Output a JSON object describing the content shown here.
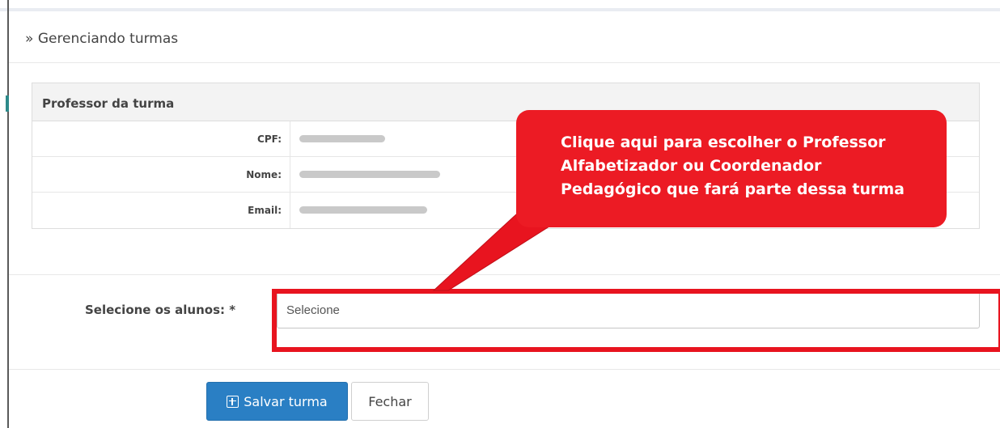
{
  "header": {
    "breadcrumb_glyph": "»",
    "title": "Gerenciando turmas"
  },
  "professor_table": {
    "heading": "Professor da turma",
    "rows": [
      {
        "label": "CPF:"
      },
      {
        "label": "Nome:"
      },
      {
        "label": "Email:"
      }
    ]
  },
  "form": {
    "students_label": "Selecione os alunos: *",
    "students_placeholder": "Selecione"
  },
  "actions": {
    "save_label": "Salvar turma",
    "close_label": "Fechar"
  },
  "annotation": {
    "callout_text": "Clique aqui para escolher o Professor Alfabetizador ou Coordenador Pedagógico que fará parte dessa turma"
  },
  "colors": {
    "accent_blue": "#2a7fc4",
    "annotation_red": "#ec1b24"
  }
}
